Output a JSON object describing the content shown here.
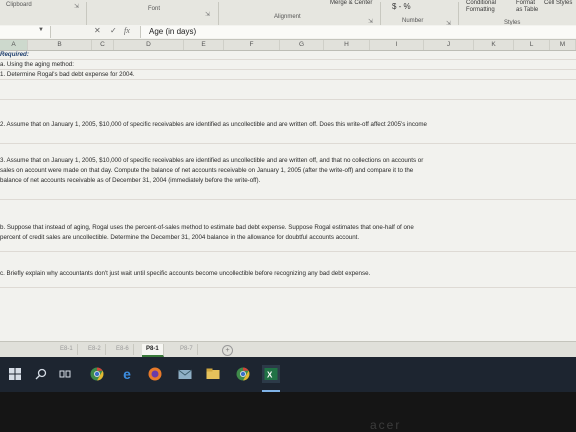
{
  "ribbon": {
    "clipboard": "Clipboard",
    "font": "Font",
    "alignment": "Alignment",
    "wrap_fragment": "Merge & Center",
    "number": "Number",
    "number_format": "$ - %",
    "conditional_formatting": "Conditional Formatting",
    "format_as_table": "Format as Table",
    "cell_styles": "Cell Styles",
    "styles": "Styles"
  },
  "formula_bar": {
    "cancel": "✕",
    "enter": "✓",
    "fx": "fx",
    "content": "Age (in days)"
  },
  "columns": [
    "A",
    "B",
    "C",
    "D",
    "E",
    "F",
    "G",
    "H",
    "I",
    "J",
    "K",
    "L",
    "M"
  ],
  "sheet_lines": [
    "Required:",
    "a. Using the aging method:",
    "1. Determine Rogal's bad debt expense for 2004.",
    "2. Assume that on January 1, 2005, $10,000 of specific receivables are identified as uncollectible and are written off. Does this write-off affect 2005's income",
    "3. Assume that on January 1, 2005, $10,000 of specific receivables are identified as uncollectible and are written off, and that no collections on accounts or",
    "sales on account were made on that day. Compute the balance of net accounts receivable on January 1, 2005 (after the write-off) and compare it to the",
    "balance of net accounts receivable as of December 31, 2004 (immediately before the write-off).",
    "b. Suppose that instead of aging, Rogal uses the percent-of-sales method to estimate bad debt expense. Suppose Rogal estimates that one-half of one",
    "percent of credit sales are uncollectible. Determine the December 31, 2004 balance in the allowance for doubtful accounts account.",
    "c. Briefly explain why accountants don't just wait until specific accounts become uncollectible before recognizing any bad debt expense."
  ],
  "sheet_tabs": [
    "E8-1",
    "E8-2",
    "E8-6",
    "P8-1",
    "P8-7"
  ],
  "active_tab": "P8-1",
  "taskbar": {
    "icons": [
      "windows-start-icon",
      "search-icon",
      "task-view-icon",
      "chrome-icon",
      "edge-icon",
      "firefox-icon",
      "mail-icon",
      "file-explorer-icon",
      "chrome-icon",
      "excel-icon"
    ]
  },
  "bezel_logo": "acer"
}
